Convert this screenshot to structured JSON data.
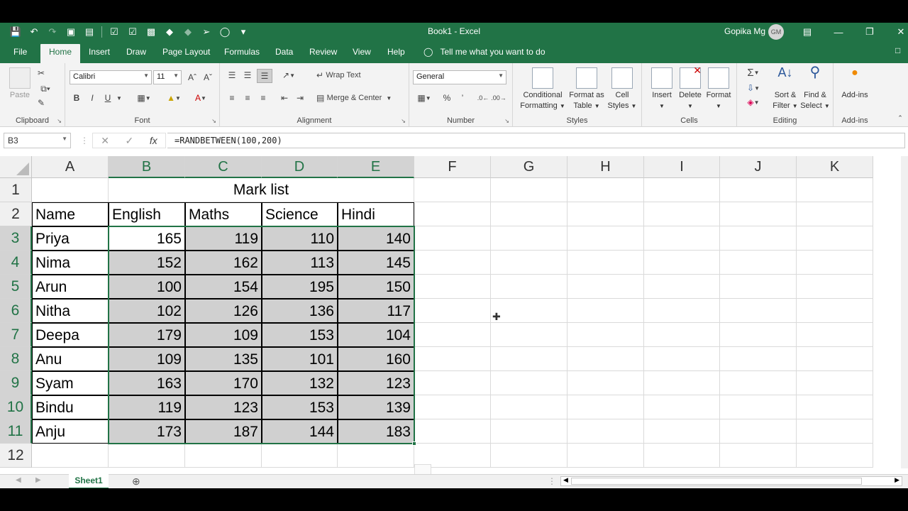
{
  "window": {
    "title": "Book1  -  Excel",
    "user_name": "Gopika Mg",
    "user_initials": "GM"
  },
  "tabs": [
    "File",
    "Home",
    "Insert",
    "Draw",
    "Page Layout",
    "Formulas",
    "Data",
    "Review",
    "View",
    "Help"
  ],
  "active_tab": "Home",
  "tell_me": "Tell me what you want to do",
  "ribbon": {
    "clipboard": {
      "label": "Clipboard",
      "paste": "Paste"
    },
    "font": {
      "label": "Font",
      "name": "Calibri",
      "size": "11",
      "bold": "B",
      "italic": "I",
      "underline": "U"
    },
    "alignment": {
      "label": "Alignment",
      "wrap": "Wrap Text",
      "merge": "Merge & Center"
    },
    "number": {
      "label": "Number",
      "format": "General"
    },
    "styles": {
      "label": "Styles",
      "conditional": "Conditional",
      "conditional2": "Formatting",
      "format_as": "Format as",
      "format_as2": "Table",
      "cell": "Cell",
      "cell2": "Styles"
    },
    "cells": {
      "label": "Cells",
      "insert": "Insert",
      "delete": "Delete",
      "format": "Format"
    },
    "editing": {
      "label": "Editing",
      "sort": "Sort &",
      "sort2": "Filter",
      "find": "Find &",
      "find2": "Select"
    },
    "addins": {
      "label": "Add-ins",
      "addins": "Add-ins"
    }
  },
  "formula_bar": {
    "name_box": "B3",
    "formula": "=RANDBETWEEN(100,200)"
  },
  "columns": [
    "A",
    "B",
    "C",
    "D",
    "E",
    "F",
    "G",
    "H",
    "I",
    "J",
    "K"
  ],
  "rows": [
    "1",
    "2",
    "3",
    "4",
    "5",
    "6",
    "7",
    "8",
    "9",
    "10",
    "11",
    "12"
  ],
  "sheet": {
    "title": "Mark list",
    "headers": [
      "Name",
      "English",
      "Maths",
      "Science",
      "Hindi"
    ],
    "records": [
      {
        "name": "Priya",
        "marks": [
          "165",
          "119",
          "110",
          "140"
        ]
      },
      {
        "name": "Nima",
        "marks": [
          "152",
          "162",
          "113",
          "145"
        ]
      },
      {
        "name": "Arun",
        "marks": [
          "100",
          "154",
          "195",
          "150"
        ]
      },
      {
        "name": "Nitha",
        "marks": [
          "102",
          "126",
          "136",
          "117"
        ]
      },
      {
        "name": "Deepa",
        "marks": [
          "179",
          "109",
          "153",
          "104"
        ]
      },
      {
        "name": "Anu",
        "marks": [
          "109",
          "135",
          "101",
          "160"
        ]
      },
      {
        "name": "Syam",
        "marks": [
          "163",
          "170",
          "132",
          "123"
        ]
      },
      {
        "name": "Bindu",
        "marks": [
          "119",
          "123",
          "153",
          "139"
        ]
      },
      {
        "name": "Anju",
        "marks": [
          "173",
          "187",
          "144",
          "183"
        ]
      }
    ]
  },
  "sheet_tabs": [
    "Sheet1"
  ],
  "accent_color": "#217346"
}
